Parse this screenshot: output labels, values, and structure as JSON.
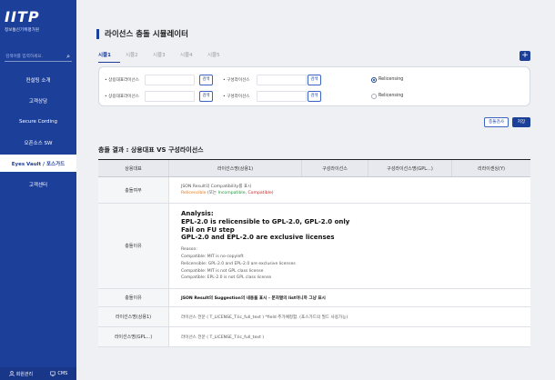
{
  "sidebar": {
    "logo_text": "IITP",
    "logo_sub": "정보통신기획평가원",
    "search_placeholder": "검색어를 입력하세요.",
    "menu": [
      {
        "label": "컨설팅 소개",
        "active": false
      },
      {
        "label": "고객상담",
        "active": false
      },
      {
        "label": "Secure Cording",
        "active": false
      },
      {
        "label": "오픈소스 SW",
        "active": false
      },
      {
        "label": "Eyes Vault / 포스가드",
        "active": true
      },
      {
        "label": "고객센터",
        "active": false
      }
    ],
    "footer": {
      "member_label": "회원관리",
      "cms_label": "CMS"
    }
  },
  "page": {
    "title": "라이선스 충돌 시뮬레이터",
    "tabs": [
      "시뮬1",
      "시뮬2",
      "시뮬3",
      "시뮬4",
      "시뮬5"
    ],
    "active_tab": 0,
    "add_label": "+"
  },
  "form": {
    "row1": {
      "label1": "상용대표라이선스",
      "label2": "구성라이선스",
      "search_label": "검색",
      "radio_label": "Relicensing",
      "radio_checked": true
    },
    "row2": {
      "label1": "상용대표라이선스",
      "label2": "구성라이선스",
      "search_label": "검색",
      "radio_label": "Relicensing",
      "radio_checked": false
    }
  },
  "actions": {
    "check_label": "충돌검사",
    "save_label": "저장"
  },
  "result": {
    "title": "충돌 결과 : 상용대표 VS 구성라이선스",
    "headers": [
      "상용대표",
      "라이선스명(상용1)",
      "구성라이선스",
      "구성라이선스명(GPL...)",
      "리라이센싱(Y)"
    ],
    "rows": {
      "compat": {
        "label": "충돌여부",
        "line1": "JSON Result의 Compatibility를 표시",
        "line2_a": "Relicencible",
        "line2_b": " (또는 ",
        "line2_c": "Incompatible",
        "line2_d": ", ",
        "line2_e": "Compatible",
        "line2_f": ")"
      },
      "reason": {
        "label": "충돌이유",
        "big": [
          "Analysis:",
          "EPL-2.0 is relicensible to GPL-2.0, GPL-2.0 only",
          "Fail on FU step",
          "GPL-2.0 and EPL-2.0 are exclusive licenses"
        ],
        "small": [
          "Reason:",
          "Compatible: MIT is no-copyleft",
          "Relicensible: GPL-2.0 and EPL-2.0 are exclusive licenses",
          "Compatible: MIT is not GPL class license",
          "Compatible: EPL-2.0 is not GPL class license"
        ]
      },
      "suggestion": {
        "label": "충돌이유",
        "text": "JSON Result의 Suggestion의 내용을 표시 - 문자열의 list이니까 그냥 표시"
      },
      "license1": {
        "label": "라이선스명(상용1)",
        "text": "라이선스 전문 ( T_LICENSE_T.lic_full_text ) *field 추가예정함. (포스가드의 필드 사용가능)"
      },
      "license2": {
        "label": "라이선스명(GPL...)",
        "text": "라이선스 전문 ( T_LICENSE_T.lic_full_text )"
      }
    }
  },
  "colors": {
    "brand": "#1c3f9a",
    "relicensible": "#e8740f",
    "incompatible": "#1e9a3a",
    "compatible": "#d11b1b"
  }
}
